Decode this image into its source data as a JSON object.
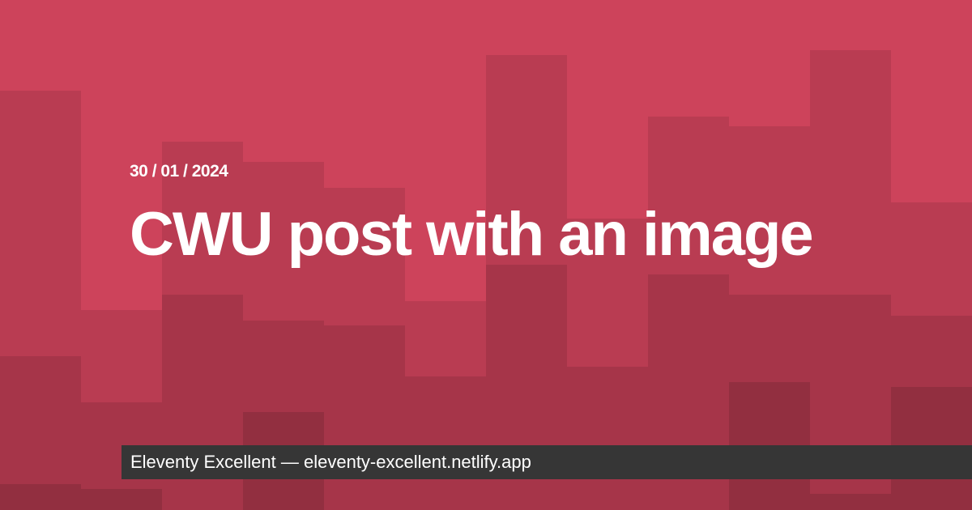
{
  "colors": {
    "background": "#cd435b",
    "layer_1": "#b93c52",
    "layer_2": "#a63549",
    "layer_3": "#922f40",
    "footer_bar": "#363636",
    "text": "#ffffff"
  },
  "post": {
    "date": "30 / 01 / 2024",
    "title": "CWU post with an image"
  },
  "footer": {
    "text": "Eleventy Excellent — eleventy-excellent.netlify.app"
  }
}
